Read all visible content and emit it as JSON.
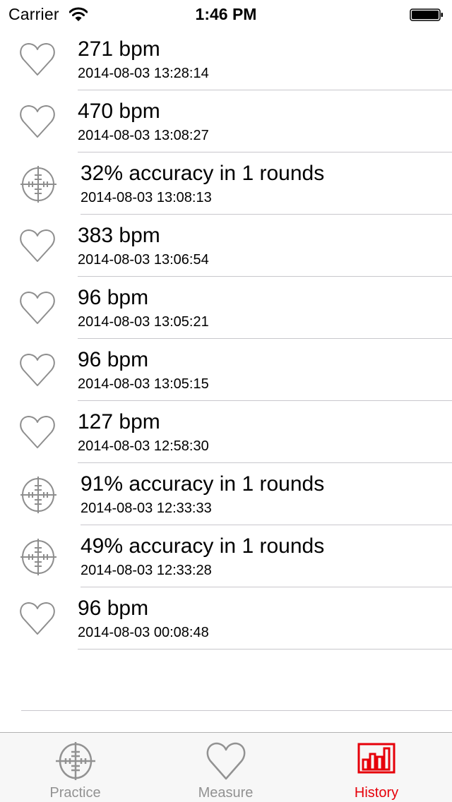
{
  "status_bar": {
    "carrier": "Carrier",
    "time": "1:46 PM",
    "wifi_icon": "wifi-icon",
    "battery_icon": "battery-icon"
  },
  "history": {
    "items": [
      {
        "type": "heart",
        "icon": "heart-icon",
        "title": "271 bpm",
        "timestamp": "2014-08-03 13:28:14"
      },
      {
        "type": "heart",
        "icon": "heart-icon",
        "title": "470 bpm",
        "timestamp": "2014-08-03 13:08:27"
      },
      {
        "type": "target",
        "icon": "crosshair-icon",
        "title": "32% accuracy in 1 rounds",
        "timestamp": "2014-08-03 13:08:13"
      },
      {
        "type": "heart",
        "icon": "heart-icon",
        "title": "383 bpm",
        "timestamp": "2014-08-03 13:06:54"
      },
      {
        "type": "heart",
        "icon": "heart-icon",
        "title": "96 bpm",
        "timestamp": "2014-08-03 13:05:21"
      },
      {
        "type": "heart",
        "icon": "heart-icon",
        "title": "96 bpm",
        "timestamp": "2014-08-03 13:05:15"
      },
      {
        "type": "heart",
        "icon": "heart-icon",
        "title": "127 bpm",
        "timestamp": "2014-08-03 12:58:30"
      },
      {
        "type": "target",
        "icon": "crosshair-icon",
        "title": "91% accuracy in 1 rounds",
        "timestamp": "2014-08-03 12:33:33"
      },
      {
        "type": "target",
        "icon": "crosshair-icon",
        "title": "49% accuracy in 1 rounds",
        "timestamp": "2014-08-03 12:33:28"
      },
      {
        "type": "heart",
        "icon": "heart-icon",
        "title": "96 bpm",
        "timestamp": "2014-08-03 00:08:48"
      }
    ]
  },
  "tab_bar": {
    "tabs": [
      {
        "label": "Practice",
        "icon": "crosshair-icon",
        "active": false
      },
      {
        "label": "Measure",
        "icon": "heart-icon",
        "active": false
      },
      {
        "label": "History",
        "icon": "bar-chart-icon",
        "active": true
      }
    ],
    "active_color": "#e6000a",
    "inactive_color": "#929292"
  },
  "colors": {
    "icon_gray": "#8e8e8e",
    "separator": "#c8c7cc",
    "tab_bar_bg": "#f7f7f7"
  }
}
